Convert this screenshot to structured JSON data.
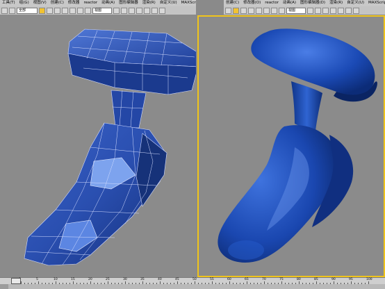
{
  "left_window": {
    "menu": [
      "工具(T)",
      "组(G)",
      "视图(V)",
      "创建(C)",
      "修改器",
      "reactor",
      "动画(A)",
      "图形编辑器",
      "渲染(R)",
      "自定义(U)",
      "MAXScript(M)"
    ],
    "toolbar": {
      "selection_filter": "全部",
      "reference_coord": "视图"
    }
  },
  "right_window": {
    "menu": [
      "创建(C)",
      "修改器(O)",
      "reactor",
      "动画(A)",
      "图形编辑器(D)",
      "渲染(R)",
      "自定义(U)",
      "MAXScript(M)"
    ],
    "toolbar": {
      "reference_coord": "视图"
    }
  },
  "timeline": {
    "frame_labels": [
      "0",
      "5",
      "10",
      "15",
      "20",
      "25",
      "30",
      "35",
      "40",
      "45",
      "50",
      "55",
      "60",
      "65",
      "70",
      "75",
      "80",
      "85",
      "90",
      "95",
      "100"
    ]
  },
  "colors": {
    "mesh_blue": "#2a4fb0",
    "mesh_light": "#5f86e0",
    "smooth_blue": "#1b4ab5",
    "viewport_bg": "#8b8b8b",
    "active_border": "#f0c41b"
  }
}
